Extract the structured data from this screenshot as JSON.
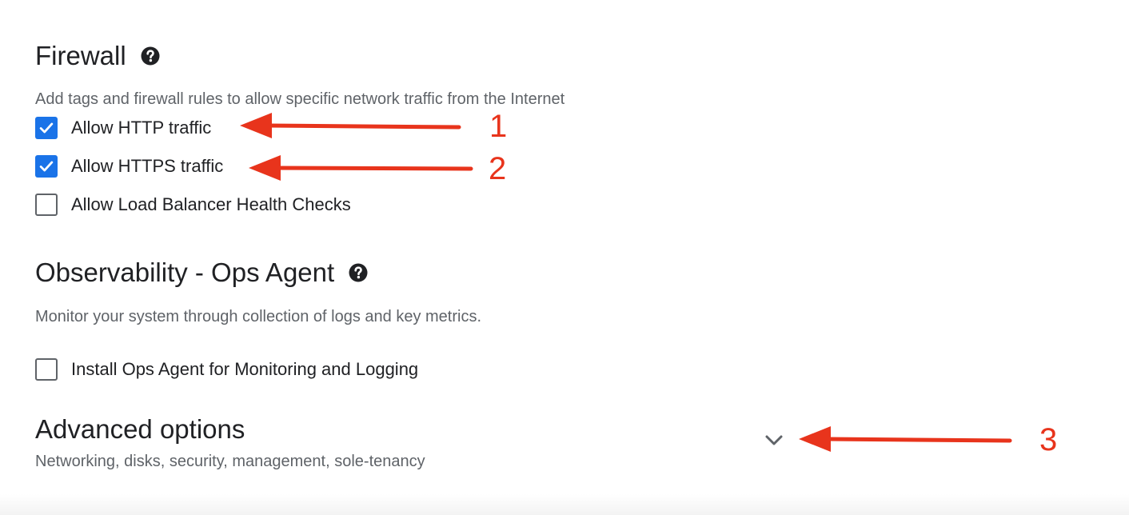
{
  "firewall": {
    "title": "Firewall",
    "help_icon": "help-circle-icon",
    "description": "Add tags and firewall rules to allow specific network traffic from the Internet",
    "options": [
      {
        "label": "Allow HTTP traffic",
        "checked": true
      },
      {
        "label": "Allow HTTPS traffic",
        "checked": true
      },
      {
        "label": "Allow Load Balancer Health Checks",
        "checked": false
      }
    ]
  },
  "observability": {
    "title": "Observability - Ops Agent",
    "help_icon": "help-circle-icon",
    "description": "Monitor your system through collection of logs and key metrics.",
    "options": [
      {
        "label": "Install Ops Agent for Monitoring and Logging",
        "checked": false
      }
    ]
  },
  "advanced": {
    "title": "Advanced options",
    "description": "Networking, disks, security, management, sole-tenancy",
    "expand_icon": "chevron-down-icon"
  },
  "annotations": {
    "labels": [
      "1",
      "2",
      "3"
    ],
    "color": "#e8341c"
  },
  "colors": {
    "checkbox_checked": "#1a73e8",
    "text_primary": "#202124",
    "text_secondary": "#5f6368"
  }
}
